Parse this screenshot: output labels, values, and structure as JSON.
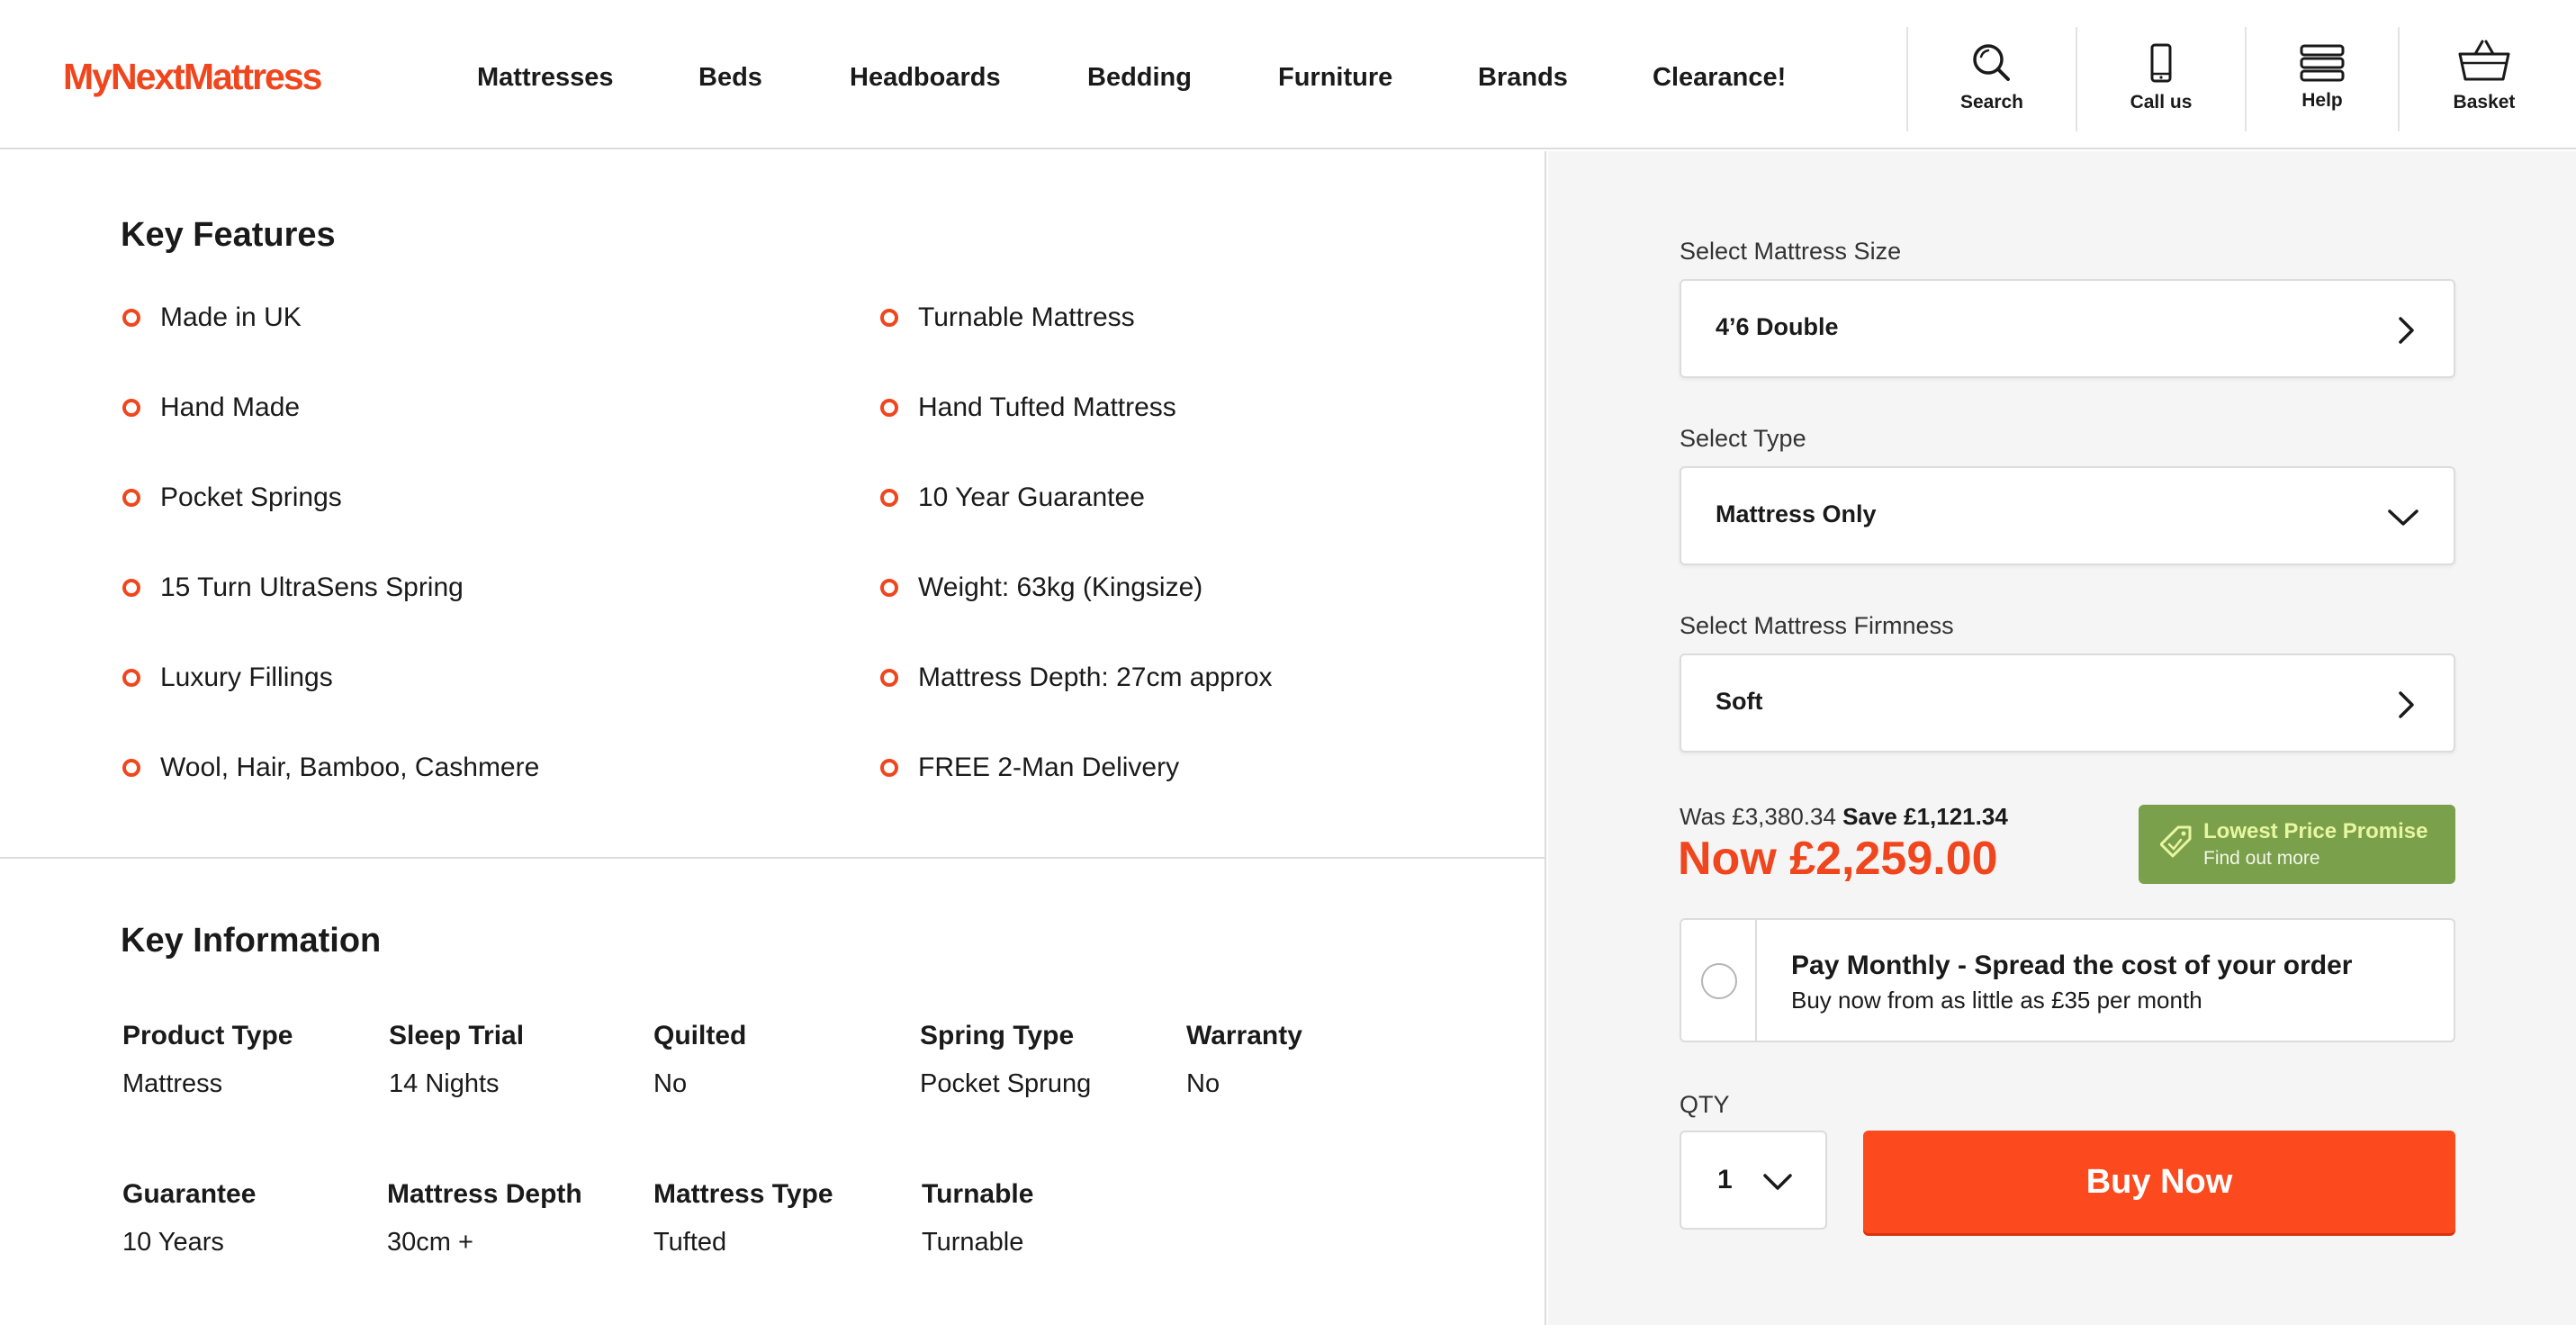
{
  "header": {
    "logo": "MyNextMattress",
    "nav": [
      "Mattresses",
      "Beds",
      "Headboards",
      "Bedding",
      "Furniture",
      "Brands",
      "Clearance!"
    ],
    "tools": [
      {
        "label": "Search",
        "icon": "search-icon"
      },
      {
        "label": "Call us",
        "icon": "phone-icon"
      },
      {
        "label": "Help",
        "icon": "menu-icon"
      },
      {
        "label": "Basket",
        "icon": "basket-icon"
      }
    ]
  },
  "key_features": {
    "title": "Key Features",
    "left": [
      "Made in UK",
      "Hand Made",
      "Pocket Springs",
      "15 Turn UltraSens Spring",
      "Luxury Fillings",
      "Wool, Hair, Bamboo, Cashmere"
    ],
    "right": [
      "Turnable Mattress",
      "Hand Tufted Mattress",
      "10 Year Guarantee",
      "Weight: 63kg (Kingsize)",
      "Mattress Depth: 27cm approx",
      "FREE 2-Man Delivery"
    ]
  },
  "key_information": {
    "title": "Key Information",
    "items": [
      {
        "label": "Product Type",
        "value": "Mattress"
      },
      {
        "label": "Sleep Trial",
        "value": "14 Nights"
      },
      {
        "label": "Quilted",
        "value": "No"
      },
      {
        "label": "Spring Type",
        "value": "Pocket Sprung"
      },
      {
        "label": "Warranty",
        "value": "No"
      },
      {
        "label": "Guarantee",
        "value": "10 Years"
      },
      {
        "label": "Mattress Depth",
        "value": "30cm +"
      },
      {
        "label": "Mattress Type",
        "value": "Tufted"
      },
      {
        "label": "Turnable",
        "value": "Turnable"
      }
    ]
  },
  "purchase": {
    "size_label": "Select Mattress Size",
    "size_value": "4’6 Double",
    "type_label": "Select Type",
    "type_value": "Mattress Only",
    "firmness_label": "Select Mattress Firmness",
    "firmness_value": "Soft",
    "was_text": "Was £3,380.34",
    "save_text": "Save £1,121.34",
    "now_text": "Now £2,259.00",
    "promise_title": "Lowest Price Promise",
    "promise_sub": "Find out more",
    "pay_title": "Pay Monthly - Spread the cost of your order",
    "pay_sub": "Buy now from as little as £35 per month",
    "qty_label": "QTY",
    "qty_value": "1",
    "buy_label": "Buy Now"
  },
  "colors": {
    "brand": "#f0461e",
    "buy_button": "#fc4a1e",
    "promise_bg": "#7aa04c",
    "panel_bg": "#f6f5f5"
  }
}
